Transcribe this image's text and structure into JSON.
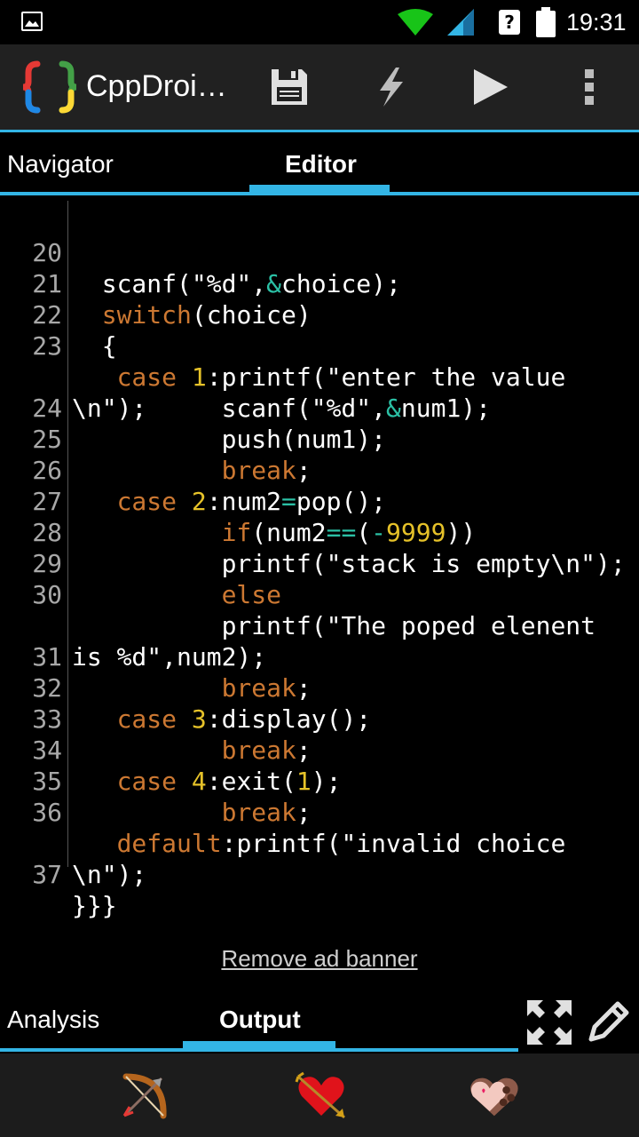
{
  "status_bar": {
    "time": "19:31",
    "icons": [
      "gallery-icon",
      "wifi-icon",
      "signal-icon",
      "help-icon",
      "battery-icon"
    ]
  },
  "app_bar": {
    "title": "CppDroi…",
    "actions": [
      "save-icon",
      "flash-icon",
      "play-icon",
      "overflow-menu-icon"
    ]
  },
  "top_tabs": [
    {
      "label": "Navigator",
      "selected": false
    },
    {
      "label": "Editor",
      "selected": true
    }
  ],
  "editor": {
    "line_numbers": [
      "20",
      "21",
      "22",
      "23",
      "",
      "24",
      "25",
      "26",
      "27",
      "28",
      "29",
      "30",
      "",
      "31",
      "32",
      "33",
      "34",
      "35",
      "36",
      "",
      "37"
    ]
  },
  "ad_link": "Remove ad banner",
  "bottom_tabs": [
    {
      "label": "Analysis",
      "selected": false
    },
    {
      "label": "Output",
      "selected": true
    }
  ],
  "bottom_actions": [
    "fullscreen-icon",
    "pencil-icon"
  ],
  "ad_banner_icons": [
    "bow-arrow-icon",
    "heart-arrow-icon",
    "love-chocolate-icon"
  ],
  "colors": {
    "accent": "#33b5e5",
    "keyword": "#cc7832",
    "number": "#e6c229",
    "operator": "#2bc0a5",
    "line_number": "#a8a8a8"
  }
}
